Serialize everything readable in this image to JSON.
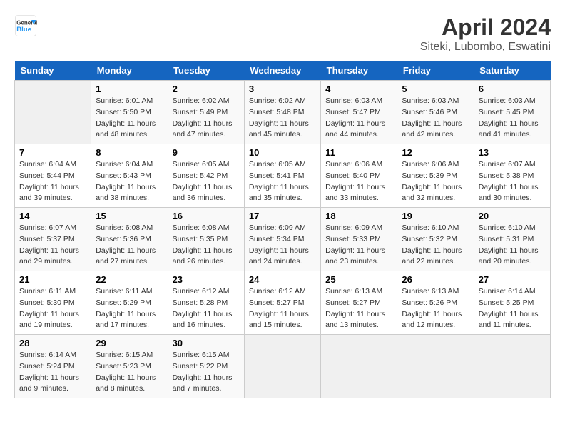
{
  "header": {
    "logo_line1": "General",
    "logo_line2": "Blue",
    "title": "April 2024",
    "subtitle": "Siteki, Lubombo, Eswatini"
  },
  "weekdays": [
    "Sunday",
    "Monday",
    "Tuesday",
    "Wednesday",
    "Thursday",
    "Friday",
    "Saturday"
  ],
  "weeks": [
    [
      {
        "day": "",
        "info": ""
      },
      {
        "day": "1",
        "info": "Sunrise: 6:01 AM\nSunset: 5:50 PM\nDaylight: 11 hours\nand 48 minutes."
      },
      {
        "day": "2",
        "info": "Sunrise: 6:02 AM\nSunset: 5:49 PM\nDaylight: 11 hours\nand 47 minutes."
      },
      {
        "day": "3",
        "info": "Sunrise: 6:02 AM\nSunset: 5:48 PM\nDaylight: 11 hours\nand 45 minutes."
      },
      {
        "day": "4",
        "info": "Sunrise: 6:03 AM\nSunset: 5:47 PM\nDaylight: 11 hours\nand 44 minutes."
      },
      {
        "day": "5",
        "info": "Sunrise: 6:03 AM\nSunset: 5:46 PM\nDaylight: 11 hours\nand 42 minutes."
      },
      {
        "day": "6",
        "info": "Sunrise: 6:03 AM\nSunset: 5:45 PM\nDaylight: 11 hours\nand 41 minutes."
      }
    ],
    [
      {
        "day": "7",
        "info": "Sunrise: 6:04 AM\nSunset: 5:44 PM\nDaylight: 11 hours\nand 39 minutes."
      },
      {
        "day": "8",
        "info": "Sunrise: 6:04 AM\nSunset: 5:43 PM\nDaylight: 11 hours\nand 38 minutes."
      },
      {
        "day": "9",
        "info": "Sunrise: 6:05 AM\nSunset: 5:42 PM\nDaylight: 11 hours\nand 36 minutes."
      },
      {
        "day": "10",
        "info": "Sunrise: 6:05 AM\nSunset: 5:41 PM\nDaylight: 11 hours\nand 35 minutes."
      },
      {
        "day": "11",
        "info": "Sunrise: 6:06 AM\nSunset: 5:40 PM\nDaylight: 11 hours\nand 33 minutes."
      },
      {
        "day": "12",
        "info": "Sunrise: 6:06 AM\nSunset: 5:39 PM\nDaylight: 11 hours\nand 32 minutes."
      },
      {
        "day": "13",
        "info": "Sunrise: 6:07 AM\nSunset: 5:38 PM\nDaylight: 11 hours\nand 30 minutes."
      }
    ],
    [
      {
        "day": "14",
        "info": "Sunrise: 6:07 AM\nSunset: 5:37 PM\nDaylight: 11 hours\nand 29 minutes."
      },
      {
        "day": "15",
        "info": "Sunrise: 6:08 AM\nSunset: 5:36 PM\nDaylight: 11 hours\nand 27 minutes."
      },
      {
        "day": "16",
        "info": "Sunrise: 6:08 AM\nSunset: 5:35 PM\nDaylight: 11 hours\nand 26 minutes."
      },
      {
        "day": "17",
        "info": "Sunrise: 6:09 AM\nSunset: 5:34 PM\nDaylight: 11 hours\nand 24 minutes."
      },
      {
        "day": "18",
        "info": "Sunrise: 6:09 AM\nSunset: 5:33 PM\nDaylight: 11 hours\nand 23 minutes."
      },
      {
        "day": "19",
        "info": "Sunrise: 6:10 AM\nSunset: 5:32 PM\nDaylight: 11 hours\nand 22 minutes."
      },
      {
        "day": "20",
        "info": "Sunrise: 6:10 AM\nSunset: 5:31 PM\nDaylight: 11 hours\nand 20 minutes."
      }
    ],
    [
      {
        "day": "21",
        "info": "Sunrise: 6:11 AM\nSunset: 5:30 PM\nDaylight: 11 hours\nand 19 minutes."
      },
      {
        "day": "22",
        "info": "Sunrise: 6:11 AM\nSunset: 5:29 PM\nDaylight: 11 hours\nand 17 minutes."
      },
      {
        "day": "23",
        "info": "Sunrise: 6:12 AM\nSunset: 5:28 PM\nDaylight: 11 hours\nand 16 minutes."
      },
      {
        "day": "24",
        "info": "Sunrise: 6:12 AM\nSunset: 5:27 PM\nDaylight: 11 hours\nand 15 minutes."
      },
      {
        "day": "25",
        "info": "Sunrise: 6:13 AM\nSunset: 5:27 PM\nDaylight: 11 hours\nand 13 minutes."
      },
      {
        "day": "26",
        "info": "Sunrise: 6:13 AM\nSunset: 5:26 PM\nDaylight: 11 hours\nand 12 minutes."
      },
      {
        "day": "27",
        "info": "Sunrise: 6:14 AM\nSunset: 5:25 PM\nDaylight: 11 hours\nand 11 minutes."
      }
    ],
    [
      {
        "day": "28",
        "info": "Sunrise: 6:14 AM\nSunset: 5:24 PM\nDaylight: 11 hours\nand 9 minutes."
      },
      {
        "day": "29",
        "info": "Sunrise: 6:15 AM\nSunset: 5:23 PM\nDaylight: 11 hours\nand 8 minutes."
      },
      {
        "day": "30",
        "info": "Sunrise: 6:15 AM\nSunset: 5:22 PM\nDaylight: 11 hours\nand 7 minutes."
      },
      {
        "day": "",
        "info": ""
      },
      {
        "day": "",
        "info": ""
      },
      {
        "day": "",
        "info": ""
      },
      {
        "day": "",
        "info": ""
      }
    ]
  ]
}
